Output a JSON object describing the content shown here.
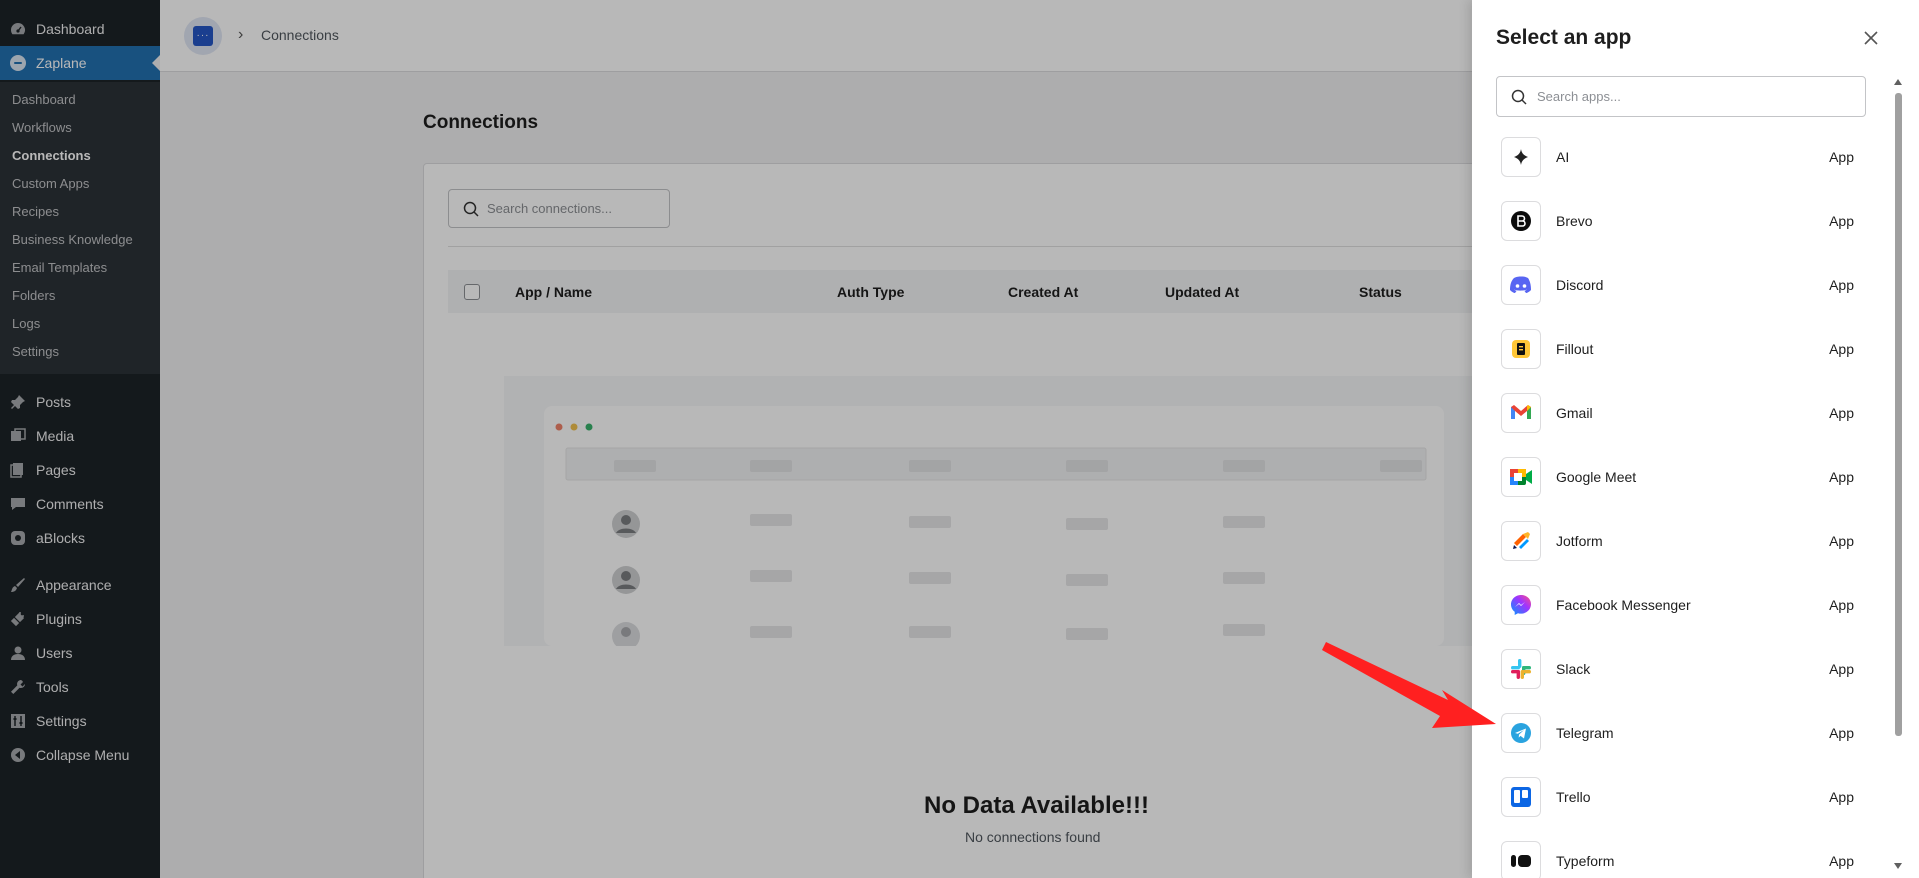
{
  "wp_menu": {
    "dashboard": "Dashboard",
    "plugin": "Zaplane",
    "submenu": [
      "Dashboard",
      "Workflows",
      "Connections",
      "Custom Apps",
      "Recipes",
      "Business Knowledge",
      "Email Templates",
      "Folders",
      "Logs",
      "Settings"
    ],
    "current_submenu": "Connections",
    "posts": "Posts",
    "media": "Media",
    "pages": "Pages",
    "comments": "Comments",
    "ablocks": "aBlocks",
    "appearance": "Appearance",
    "plugins": "Plugins",
    "users": "Users",
    "tools": "Tools",
    "settings": "Settings",
    "collapse": "Collapse Menu"
  },
  "header": {
    "breadcrumb": "Connections"
  },
  "page": {
    "title": "Connections",
    "search_placeholder": "Search connections...",
    "columns": [
      "App / Name",
      "Auth Type",
      "Created At",
      "Updated At",
      "Status"
    ],
    "empty_title": "No Data Available!!!",
    "empty_subtitle": "No connections found"
  },
  "drawer": {
    "title": "Select an app",
    "search_placeholder": "Search apps...",
    "apps": [
      {
        "name": "AI",
        "tag": "App",
        "icon": "sparkle-icon"
      },
      {
        "name": "Brevo",
        "tag": "App",
        "icon": "brevo-icon"
      },
      {
        "name": "Discord",
        "tag": "App",
        "icon": "discord-icon"
      },
      {
        "name": "Fillout",
        "tag": "App",
        "icon": "fillout-icon"
      },
      {
        "name": "Gmail",
        "tag": "App",
        "icon": "gmail-icon"
      },
      {
        "name": "Google Meet",
        "tag": "App",
        "icon": "google-meet-icon"
      },
      {
        "name": "Jotform",
        "tag": "App",
        "icon": "jotform-icon"
      },
      {
        "name": "Facebook Messenger",
        "tag": "App",
        "icon": "messenger-icon"
      },
      {
        "name": "Slack",
        "tag": "App",
        "icon": "slack-icon"
      },
      {
        "name": "Telegram",
        "tag": "App",
        "icon": "telegram-icon"
      },
      {
        "name": "Trello",
        "tag": "App",
        "icon": "trello-icon"
      },
      {
        "name": "Typeform",
        "tag": "App",
        "icon": "typeform-icon"
      }
    ]
  },
  "colors": {
    "sidebar_bg": "#1d2327",
    "active_menu": "#2271b1",
    "annotation_arrow": "#ff2020"
  }
}
